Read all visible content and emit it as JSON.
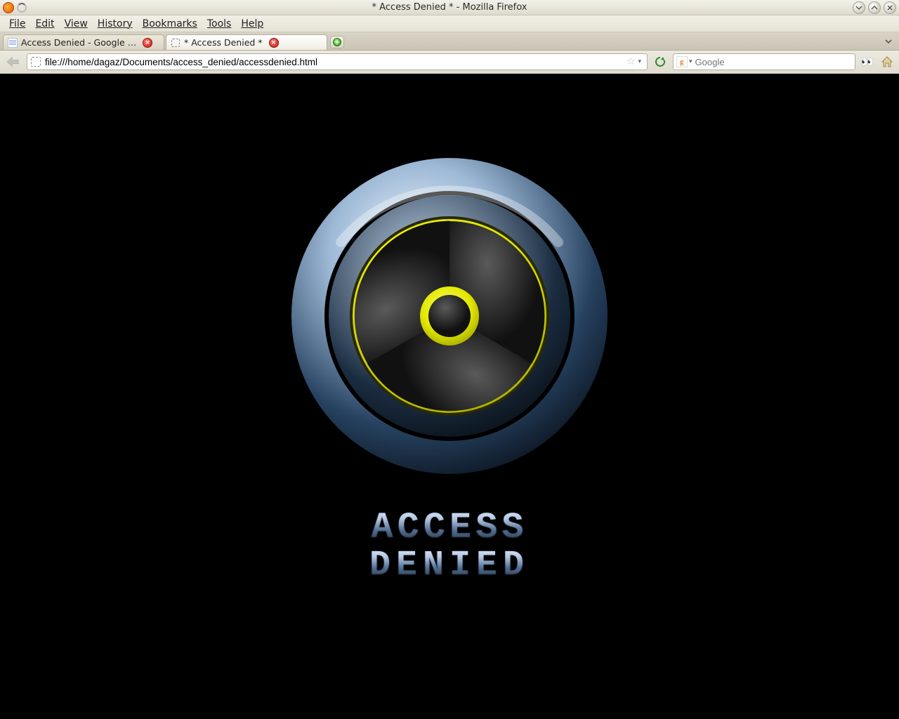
{
  "window": {
    "title": "* Access Denied * - Mozilla Firefox"
  },
  "menu": {
    "file": "File",
    "edit": "Edit",
    "view": "View",
    "history": "History",
    "bookmarks": "Bookmarks",
    "tools": "Tools",
    "help": "Help"
  },
  "tabs": [
    {
      "label": "Access Denied - Google …",
      "favicon": "doc"
    },
    {
      "label": "* Access Denied *",
      "favicon": "dash"
    }
  ],
  "url_bar": {
    "value": "file:///home/dagaz/Documents/access_denied/accessdenied.html"
  },
  "search": {
    "placeholder": "Google"
  },
  "content": {
    "line1": "ACCESS",
    "line2": "DENIED"
  }
}
